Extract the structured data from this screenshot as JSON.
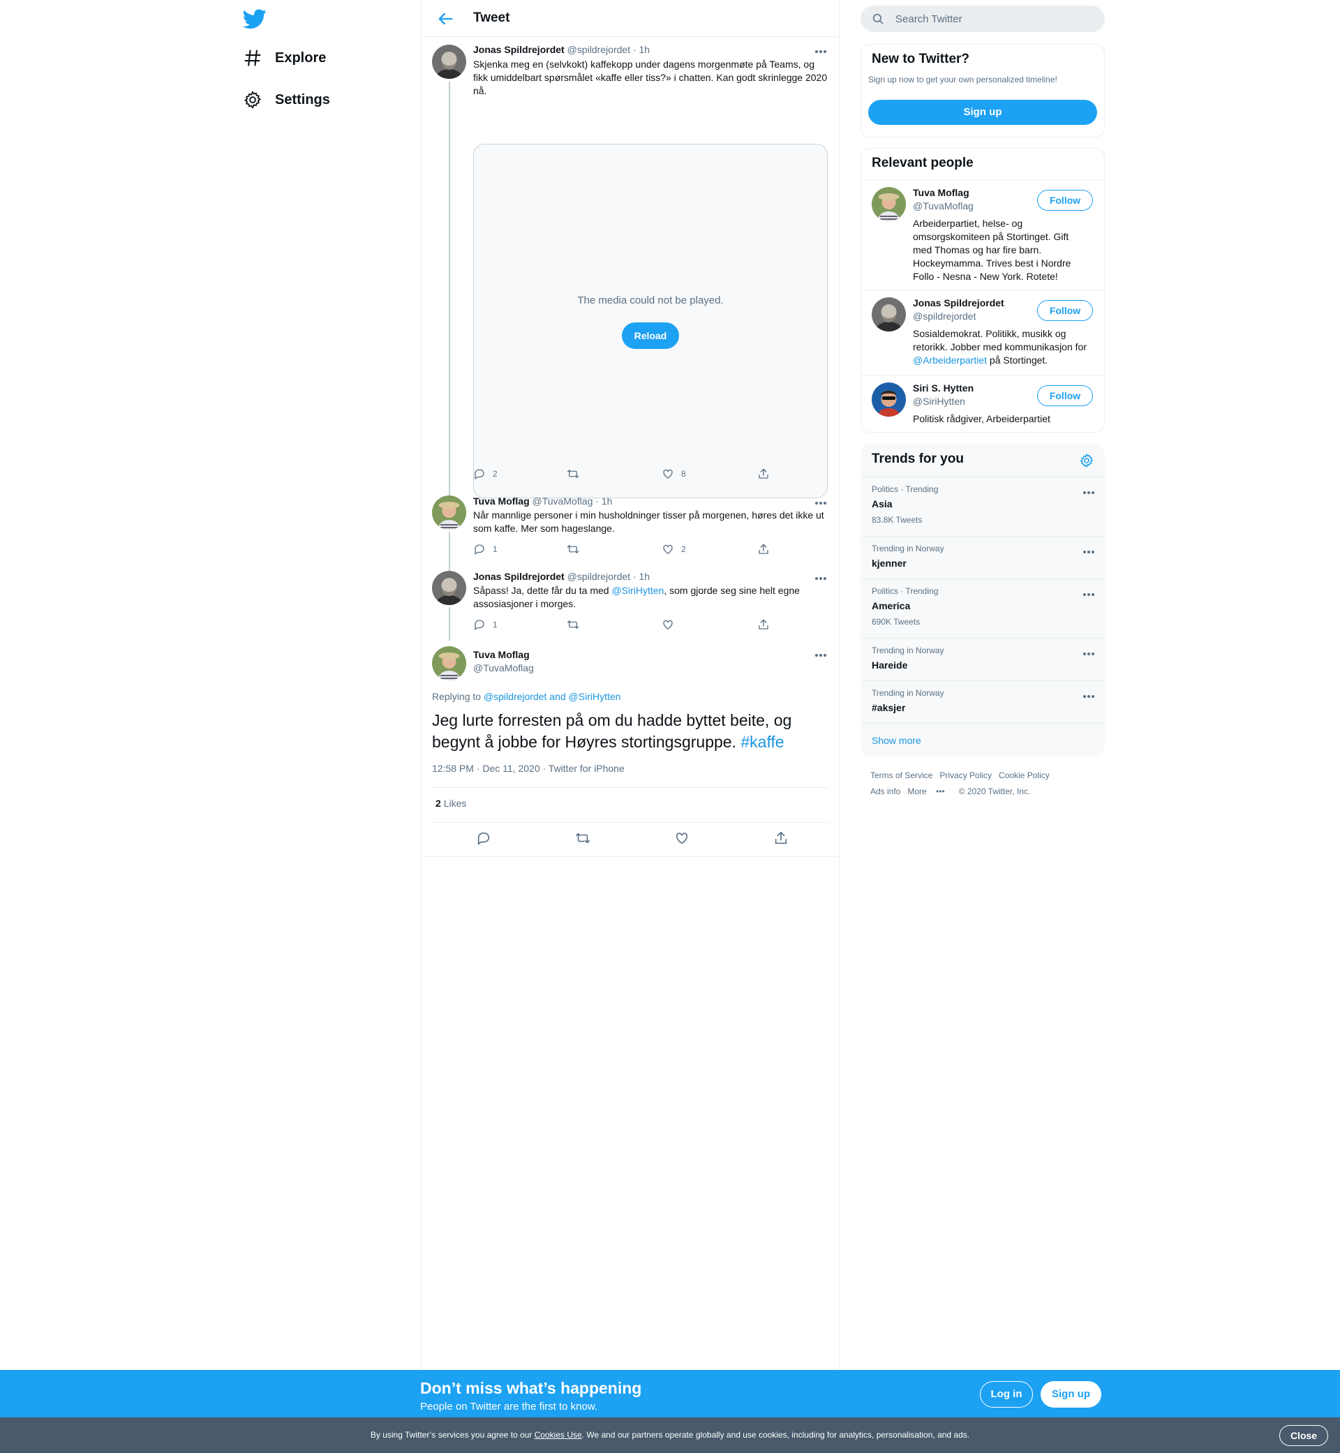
{
  "nav": {
    "items": [
      {
        "label": "Explore",
        "icon": "hashtag-icon"
      },
      {
        "label": "Settings",
        "icon": "gear-icon"
      }
    ]
  },
  "header": {
    "title": "Tweet"
  },
  "thread": [
    {
      "name": "Jonas Spildrejordet",
      "handle": "@spildrejordet",
      "time": "· 1h",
      "text": "Skjenka meg en (selvkokt) kaffekopp under dagens morgenmøte på Teams, og fikk umiddelbart spørsmålet «kaffe eller tiss?» i chatten. Kan godt skrinlegge 2020 nå.",
      "media": {
        "message": "The media could not be played.",
        "reload_label": "Reload"
      },
      "replies": "2",
      "retweets": "",
      "likes": "8"
    },
    {
      "name": "Tuva Moflag",
      "handle": "@TuvaMoflag",
      "time": "· 1h",
      "text": "Når mannlige personer i min husholdninger tisser på morgenen, høres det ikke ut som kaffe. Mer som hageslange.",
      "replies": "1",
      "retweets": "",
      "likes": "2"
    },
    {
      "name": "Jonas Spildrejordet",
      "handle": "@spildrejordet",
      "time": "· 1h",
      "text_before": "Såpass! Ja, dette får du ta med ",
      "mention": "@SiriHytten",
      "text_after": ", som gjorde seg sine helt egne assosiasjoner i morges.",
      "replies": "1",
      "retweets": "",
      "likes": ""
    }
  ],
  "focus": {
    "name": "Tuva Moflag",
    "handle": "@TuvaMoflag",
    "replying_prefix": "Replying to ",
    "replying_to": "@spildrejordet and @SiriHytten",
    "text": "Jeg lurte forresten på om du hadde byttet beite, og begynt å jobbe for Høyres stortingsgruppe. ",
    "hashtag": "#kaffe",
    "meta": "12:58 PM · Dec 11, 2020 · Twitter for iPhone",
    "likes_count": "2",
    "likes_label": "Likes"
  },
  "search": {
    "placeholder": "Search Twitter"
  },
  "new_to_twitter": {
    "title": "New to Twitter?",
    "subtitle": "Sign up now to get your own personalized timeline!",
    "button": "Sign up"
  },
  "relevant_people": {
    "title": "Relevant people",
    "follow_label": "Follow",
    "people": [
      {
        "name": "Tuva Moflag",
        "handle": "@TuvaMoflag",
        "bio": "Arbeiderpartiet, helse- og omsorgskomiteen på Stortinget. Gift med Thomas og har fire barn. Hockeymamma. Trives best i Nordre Follo - Nesna - New York. Rotete!"
      },
      {
        "name": "Jonas Spildrejordet",
        "handle": "@spildrejordet",
        "bio_before": "Sosialdemokrat. Politikk, musikk og retorikk. Jobber med kommunikasjon for ",
        "bio_mention": "@Arbeiderpartiet",
        "bio_after": " på Stortinget."
      },
      {
        "name": "Siri S. Hytten",
        "handle": "@SiriHytten",
        "bio": "Politisk rådgiver, Arbeiderpartiet"
      }
    ]
  },
  "trends": {
    "title": "Trends for you",
    "items": [
      {
        "context": "Politics · Trending",
        "name": "Asia",
        "count": "83.8K Tweets"
      },
      {
        "context": "Trending in Norway",
        "name": "kjenner",
        "count": ""
      },
      {
        "context": "Politics · Trending",
        "name": "America",
        "count": "690K Tweets"
      },
      {
        "context": "Trending in Norway",
        "name": "Hareide",
        "count": ""
      },
      {
        "context": "Trending in Norway",
        "name": "#aksjer",
        "count": ""
      }
    ],
    "show_more": "Show more"
  },
  "footer": {
    "terms": "Terms of Service",
    "privacy": "Privacy Policy",
    "cookie": "Cookie Policy",
    "ads": "Ads info",
    "more": "More",
    "copyright": "© 2020 Twitter, Inc."
  },
  "bottom_bar": {
    "title": "Don’t miss what’s happening",
    "subtitle": "People on Twitter are the first to know.",
    "login": "Log in",
    "signup": "Sign up"
  },
  "cookie_bar": {
    "text_before": "By using Twitter’s services you agree to our ",
    "link": "Cookies Use",
    "text_after": ". We and our partners operate globally and use cookies, including for analytics, personalisation, and ads.",
    "close": "Close"
  },
  "colors": {
    "accent": "#1da1f2",
    "link": "#1b95e0",
    "muted": "#5b7083",
    "cookie_bar": "#485a6b"
  }
}
